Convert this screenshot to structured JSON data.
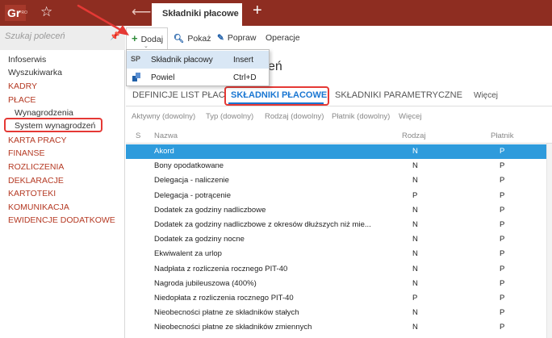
{
  "app": {
    "logo_text": "Gr",
    "logo_sup": "PRO",
    "tab_title": "Składniki płacowe",
    "brand_color": "#8e2d21"
  },
  "sidebar": {
    "search_placeholder": "Szukaj poleceń",
    "items": [
      {
        "label": "Infoserwis",
        "kind": "item"
      },
      {
        "label": "Wyszukiwarka",
        "kind": "item"
      },
      {
        "label": "KADRY",
        "kind": "category"
      },
      {
        "label": "PŁACE",
        "kind": "category"
      },
      {
        "label": "Wynagrodzenia",
        "kind": "sub"
      },
      {
        "label": "System wynagrodzeń",
        "kind": "sub"
      },
      {
        "label": "KARTA PRACY",
        "kind": "category"
      },
      {
        "label": "FINANSE",
        "kind": "category"
      },
      {
        "label": "ROZLICZENIA",
        "kind": "category"
      },
      {
        "label": "DEKLARACJE",
        "kind": "category"
      },
      {
        "label": "KARTOTEKI",
        "kind": "category"
      },
      {
        "label": "KOMUNIKACJA",
        "kind": "category"
      },
      {
        "label": "EWIDENCJE DODATKOWE",
        "kind": "category"
      }
    ]
  },
  "toolbar": {
    "add_label": "Dodaj",
    "show_label": "Pokaż",
    "edit_label": "Popraw",
    "ops_label": "Operacje"
  },
  "dropdown": {
    "items": [
      {
        "badge": "SP",
        "label": "Składnik płacowy",
        "shortcut": "Insert"
      },
      {
        "badge": "",
        "label": "Powiel",
        "shortcut": "Ctrl+D"
      }
    ]
  },
  "heading_fragment": "eń",
  "tabs": {
    "items": [
      "DEFINICJE LIST PŁAC",
      "SKŁADNIKI PŁACOWE",
      "SKŁADNIKI PARAMETRYCZNE",
      "Więcej"
    ],
    "active_index": 1
  },
  "filters": [
    "Aktywny (dowolny)",
    "Typ (dowolny)",
    "Rodzaj (dowolny)",
    "Płatnik (dowolny)",
    "Więcej"
  ],
  "table": {
    "columns": [
      "S",
      "Nazwa",
      "Rodzaj",
      "Płatnik"
    ],
    "rows": [
      {
        "name": "Akord",
        "rodzaj": "N",
        "platnik": "P"
      },
      {
        "name": "Bony opodatkowane",
        "rodzaj": "N",
        "platnik": "P"
      },
      {
        "name": "Delegacja - naliczenie",
        "rodzaj": "N",
        "platnik": "P"
      },
      {
        "name": "Delegacja - potrącenie",
        "rodzaj": "P",
        "platnik": "P"
      },
      {
        "name": "Dodatek za godziny nadliczbowe",
        "rodzaj": "N",
        "platnik": "P"
      },
      {
        "name": "Dodatek za godziny nadliczbowe z okresów dłuższych niż mie...",
        "rodzaj": "N",
        "platnik": "P"
      },
      {
        "name": "Dodatek za godziny nocne",
        "rodzaj": "N",
        "platnik": "P"
      },
      {
        "name": "Ekwiwalent za urlop",
        "rodzaj": "N",
        "platnik": "P"
      },
      {
        "name": "Nadpłata z rozliczenia rocznego PIT-40",
        "rodzaj": "N",
        "platnik": "P"
      },
      {
        "name": "Nagroda jubileuszowa (400%)",
        "rodzaj": "N",
        "platnik": "P"
      },
      {
        "name": "Niedopłata z rozliczenia rocznego PIT-40",
        "rodzaj": "P",
        "platnik": "P"
      },
      {
        "name": "Nieobecności płatne ze składników stałych",
        "rodzaj": "N",
        "platnik": "P"
      },
      {
        "name": "Nieobecności płatne ze składników zmiennych",
        "rodzaj": "N",
        "platnik": "P"
      }
    ],
    "selected_index": 0
  }
}
